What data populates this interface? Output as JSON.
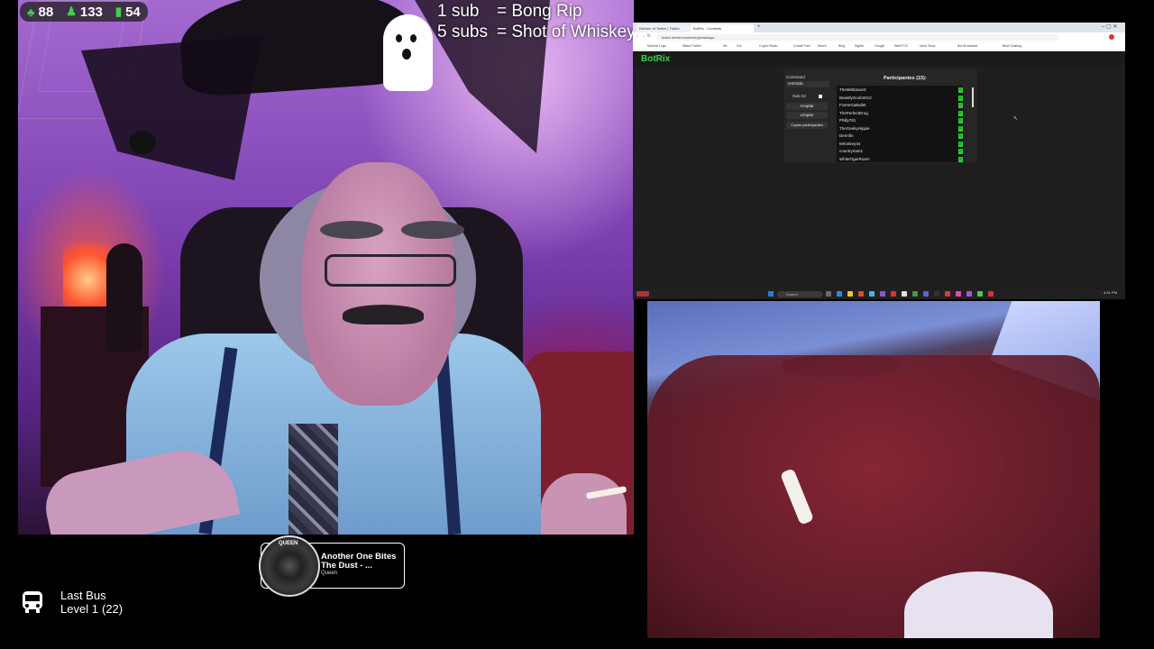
{
  "overlay": {
    "stats": [
      {
        "icon": "followers-icon",
        "value": "88"
      },
      {
        "icon": "viewers-icon",
        "value": "133"
      },
      {
        "icon": "bits-icon",
        "value": "54"
      }
    ],
    "sub_rules": [
      {
        "count": "1 sub",
        "reward": "= Bong Rip"
      },
      {
        "count": "5 subs",
        "reward": "= Shot of Whiskey"
      }
    ],
    "now_playing": {
      "album_art_text": "QUEEN",
      "title": "Another One Bites The Dust - ...",
      "artist": "Queen"
    },
    "bus": {
      "name": "Last Bus",
      "level": "Level 1",
      "count": "(22)"
    }
  },
  "browser": {
    "tabs": [
      "Kitchen of Twitch | Twitch",
      "BotRix - Contests"
    ],
    "url": "botrix.live/en/contests/giveaways",
    "bookmarks": [
      "Nuclear Logs",
      "Watch Twitch",
      "Ifix",
      "Gui",
      "Crypto Radio",
      "Create Free",
      "Merch",
      "Bing",
      "Digital",
      "Google",
      "WebVTIC",
      "Neon Shop",
      "Bot Broadcast",
      "Best Chatting"
    ],
    "app_name": "BotRix",
    "command_label": "Command",
    "command_value": "!entrada",
    "sub_label": "Sub X2",
    "accept_button": "Aceptar",
    "clear_button": "Limpiar",
    "copy_button": "Copiar participantes",
    "participants_title": "Participantes (15):",
    "participants": [
      "TheMeltdown3",
      "BeastlyGoob2012",
      "FiveInGaBallet",
      "ThePerfectDrug",
      "Philly781",
      "TheGeekyHippie",
      "Dennfin",
      "Mrlonkey34",
      "countryman1",
      "WhiteTigerRoam"
    ]
  },
  "taskbar": {
    "search_placeholder": "Search",
    "clock": "4:51 PM"
  },
  "colors": {
    "accent_green": "#37d24a",
    "cam_purple": "#8a4fc0"
  }
}
